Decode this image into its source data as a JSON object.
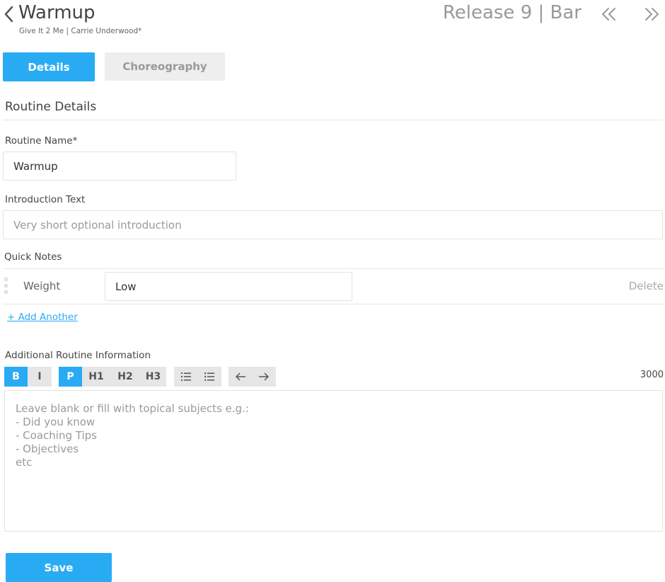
{
  "header": {
    "title": "Warmup",
    "subtitle": "Give It 2 Me | Carrie Underwood*",
    "release": "Release 9 | Bar",
    "icons": {
      "back": "chevron-left-icon",
      "prev": "double-chevron-left-icon",
      "next": "double-chevron-right-icon"
    }
  },
  "tabs": [
    {
      "label": "Details",
      "active": true
    },
    {
      "label": "Choreography",
      "active": false
    }
  ],
  "section": {
    "title": "Routine Details"
  },
  "fields": {
    "routine_name": {
      "label": "Routine Name*",
      "value": "Warmup"
    },
    "intro": {
      "label": "Introduction Text",
      "placeholder": "Very short optional introduction"
    }
  },
  "quick_notes": {
    "label": "Quick Notes",
    "items": [
      {
        "key": "Weight",
        "value": "Low",
        "delete_label": "Delete"
      }
    ],
    "add_label": "+ Add Another"
  },
  "additional": {
    "label": "Additional Routine Information",
    "toolbar": {
      "bold": "B",
      "italic": "I",
      "paragraph": "P",
      "h1": "H1",
      "h2": "H2",
      "h3": "H3",
      "icons": [
        "ordered-list-icon",
        "bullet-list-icon",
        "undo-icon",
        "redo-icon"
      ]
    },
    "char_count": "3000",
    "placeholder": "Leave blank or fill with topical subjects e.g.:\n- Did you know\n- Coaching Tips\n- Objectives\netc"
  },
  "save_label": "Save",
  "colors": {
    "accent": "#29abf4",
    "muted": "#999999",
    "tab_inactive": "#eeeeee"
  }
}
